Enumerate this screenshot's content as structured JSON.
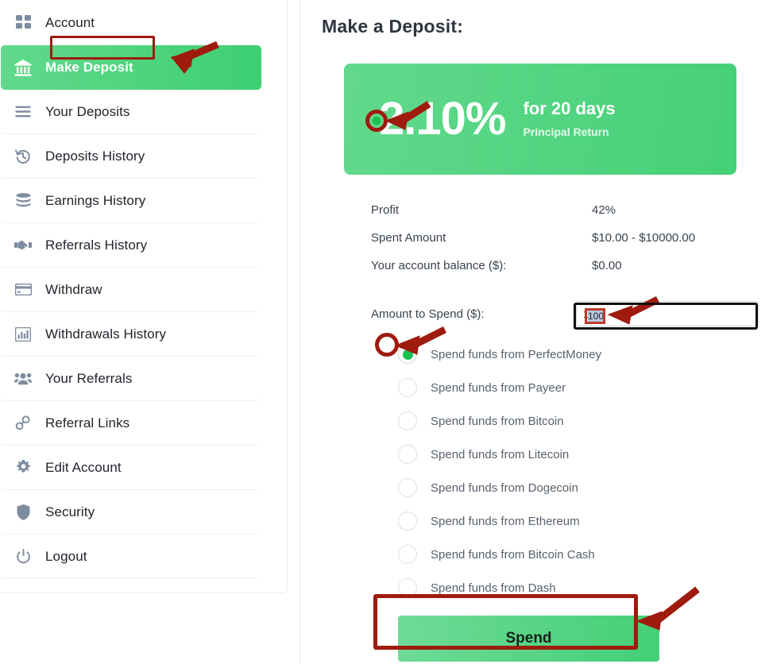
{
  "sidebar": {
    "items": [
      {
        "label": "Account",
        "icon": "grid-icon",
        "active": false
      },
      {
        "label": "Make Deposit",
        "icon": "bank-icon",
        "active": true
      },
      {
        "label": "Your Deposits",
        "icon": "menu-lines-icon",
        "active": false
      },
      {
        "label": "Deposits History",
        "icon": "history-clock-icon",
        "active": false
      },
      {
        "label": "Earnings History",
        "icon": "coins-stack-icon",
        "active": false
      },
      {
        "label": "Referrals History",
        "icon": "handshake-icon",
        "active": false
      },
      {
        "label": "Withdraw",
        "icon": "credit-card-icon",
        "active": false
      },
      {
        "label": "Withdrawals History",
        "icon": "bar-chart-icon",
        "active": false
      },
      {
        "label": "Your Referrals",
        "icon": "users-group-icon",
        "active": false
      },
      {
        "label": "Referral Links",
        "icon": "link-chain-icon",
        "active": false
      },
      {
        "label": "Edit Account",
        "icon": "gear-icon",
        "active": false
      },
      {
        "label": "Security",
        "icon": "shield-icon",
        "active": false
      },
      {
        "label": "Logout",
        "icon": "power-icon",
        "active": false
      }
    ]
  },
  "main": {
    "title": "Make a Deposit:",
    "plan": {
      "rate": "2.10%",
      "days": "for 20 days",
      "subtitle": "Principal Return"
    },
    "facts": [
      {
        "label": "Profit",
        "value": "42%"
      },
      {
        "label": "Spent Amount",
        "value": "$10.00 - $10000.00"
      },
      {
        "label": "Your account balance ($):",
        "value": "$0.00"
      }
    ],
    "amount": {
      "label": "Amount to Spend ($):",
      "value": "100",
      "placeholder": ""
    },
    "methods": [
      {
        "label": "Spend funds from PerfectMoney",
        "checked": true
      },
      {
        "label": "Spend funds from Payeer",
        "checked": false
      },
      {
        "label": "Spend funds from Bitcoin",
        "checked": false
      },
      {
        "label": "Spend funds from Litecoin",
        "checked": false
      },
      {
        "label": "Spend funds from Dogecoin",
        "checked": false
      },
      {
        "label": "Spend funds from Ethereum",
        "checked": false
      },
      {
        "label": "Spend funds from Bitcoin Cash",
        "checked": false
      },
      {
        "label": "Spend funds from Dash",
        "checked": false
      }
    ],
    "spend_button": "Spend"
  },
  "colors": {
    "accent_green": "#45d077",
    "banner_green_light": "#62d98c",
    "annotation_red": "#9e1b0e",
    "radio_green": "#18c252",
    "icon_gray": "#7e8ca0"
  }
}
